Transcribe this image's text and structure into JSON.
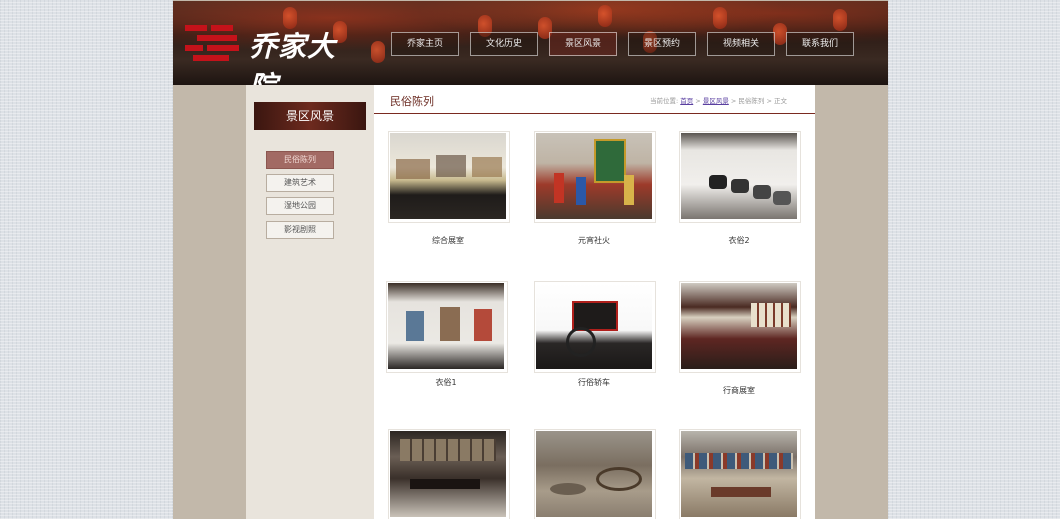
{
  "header": {
    "logo_text": "乔家大院",
    "nav": [
      {
        "label": "乔家主页",
        "active": false
      },
      {
        "label": "文化历史",
        "active": false
      },
      {
        "label": "景区风景",
        "active": true
      },
      {
        "label": "景区预约",
        "active": false
      },
      {
        "label": "视频相关",
        "active": false
      },
      {
        "label": "联系我们",
        "active": false
      }
    ]
  },
  "sidebar": {
    "title": "景区风景",
    "items": [
      {
        "label": "民俗陈列",
        "active": true
      },
      {
        "label": "建筑艺术",
        "active": false
      },
      {
        "label": "湿地公园",
        "active": false
      },
      {
        "label": "影视剧照",
        "active": false
      }
    ]
  },
  "main": {
    "title": "民俗陈列",
    "breadcrumb": {
      "prefix": "当前位置:",
      "home": "首页",
      "sep1": " > ",
      "section": "景区风景",
      "sep2": " > ",
      "category": "民俗陈列",
      "sep3": " > ",
      "current": "正文"
    },
    "gallery": [
      {
        "caption": "综合展室",
        "theme": "gallery-room"
      },
      {
        "caption": "元宵社火",
        "theme": "festival-figures"
      },
      {
        "caption": "衣俗2",
        "theme": "shoes-display"
      },
      {
        "caption": "衣俗1",
        "theme": "clothes-display"
      },
      {
        "caption": "行俗轿车",
        "theme": "carriage"
      },
      {
        "caption": "行商展室",
        "theme": "merchant-room"
      },
      {
        "caption": "",
        "theme": "furniture-room"
      },
      {
        "caption": "",
        "theme": "courtyard-cart"
      },
      {
        "caption": "",
        "theme": "street-model"
      }
    ]
  },
  "colors": {
    "accent": "#6b2b22",
    "sidebar_active": "#a26a64",
    "frame": "#c2b8aa"
  }
}
